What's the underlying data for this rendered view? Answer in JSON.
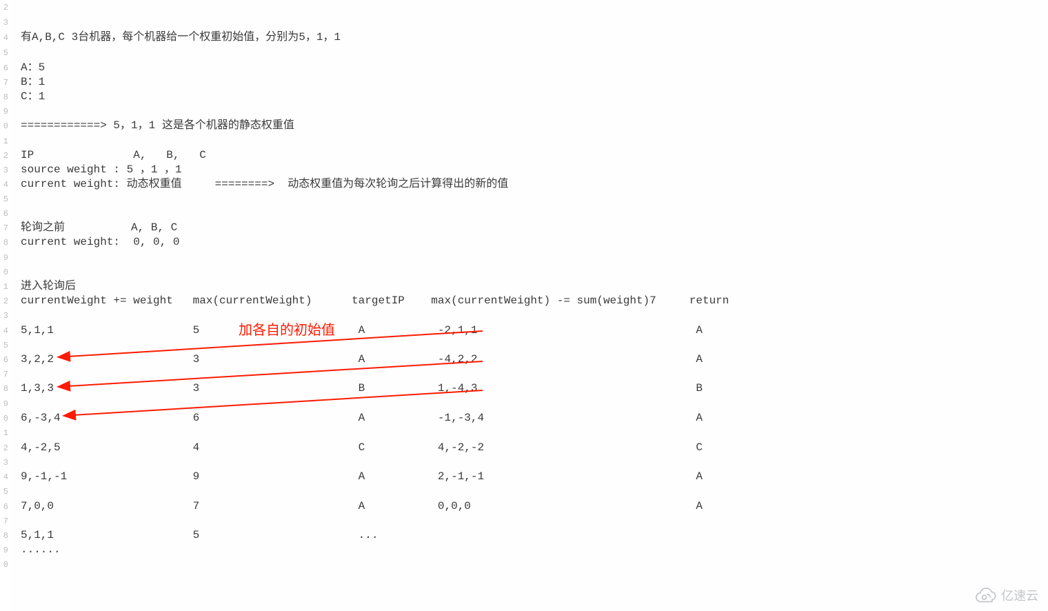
{
  "gutter": {
    "digits": [
      "2",
      "3",
      "4",
      "5",
      "6",
      "7",
      "8",
      "9",
      "0",
      "1",
      "2",
      "3",
      "4",
      "5",
      "6",
      "7",
      "8",
      "9",
      "0",
      "1",
      "2",
      "3",
      "4",
      "5",
      "6",
      "7",
      "8",
      "9",
      "0",
      "1",
      "2",
      "3",
      "4",
      "5",
      "6",
      "7",
      "8",
      "9",
      "0"
    ]
  },
  "lines": {
    "l1": "有A,B,C 3台机器，每个机器给一个权重初始值，分别为5，1，1",
    "l2": "A：5",
    "l3": "B：1",
    "l4": "C：1",
    "l5": "============> 5，1，1 这是各个机器的静态权重值",
    "l6": "IP               A,   B,   C",
    "l7": "source weight : 5 ，1 ，1",
    "l8": "current weight: 动态权重值     ========>  动态权重值为每次轮询之后计算得出的新的值",
    "l9": "轮询之前          A, B, C",
    "l10": "current weight:  0, 0, 0",
    "l11": "进入轮询后",
    "l12": "currentWeight += weight   max(currentWeight)      targetIP    max(currentWeight) -= sum(weight)7     return",
    "r1": "5,1,1                     5                        A           -2,1,1                                 A",
    "r2": "3,2,2                     3                        A           -4,2,2                                 A",
    "r3": "1,3,3                     3                        B           1,-4,3                                 B",
    "r4": "6,-3,4                    6                        A           -1,-3,4                                A",
    "r5": "4,-2,5                    4                        C           4,-2,-2                                C",
    "r6": "9,-1,-1                   9                        A           2,-1,-1                                A",
    "r7": "7,0,0                     7                        A           0,0,0                                  A",
    "r8": "5,1,1                     5                        ...",
    "r9": "......"
  },
  "annotation": {
    "text": "加各自的初始值"
  },
  "watermark": {
    "text": "亿速云"
  },
  "table_data": {
    "columns": [
      "currentWeight += weight",
      "max(currentWeight)",
      "targetIP",
      "max(currentWeight) -= sum(weight)7",
      "return"
    ],
    "rows": [
      {
        "cw": "5,1,1",
        "max": "5",
        "target": "A",
        "after": "-2,1,1",
        "return": "A"
      },
      {
        "cw": "3,2,2",
        "max": "3",
        "target": "A",
        "after": "-4,2,2",
        "return": "A"
      },
      {
        "cw": "1,3,3",
        "max": "3",
        "target": "B",
        "after": "1,-4,3",
        "return": "B"
      },
      {
        "cw": "6,-3,4",
        "max": "6",
        "target": "A",
        "after": "-1,-3,4",
        "return": "A"
      },
      {
        "cw": "4,-2,5",
        "max": "4",
        "target": "C",
        "after": "4,-2,-2",
        "return": "C"
      },
      {
        "cw": "9,-1,-1",
        "max": "9",
        "target": "A",
        "after": "2,-1,-1",
        "return": "A"
      },
      {
        "cw": "7,0,0",
        "max": "7",
        "target": "A",
        "after": "0,0,0",
        "return": "A"
      },
      {
        "cw": "5,1,1",
        "max": "5",
        "target": "...",
        "after": "",
        "return": ""
      }
    ]
  }
}
